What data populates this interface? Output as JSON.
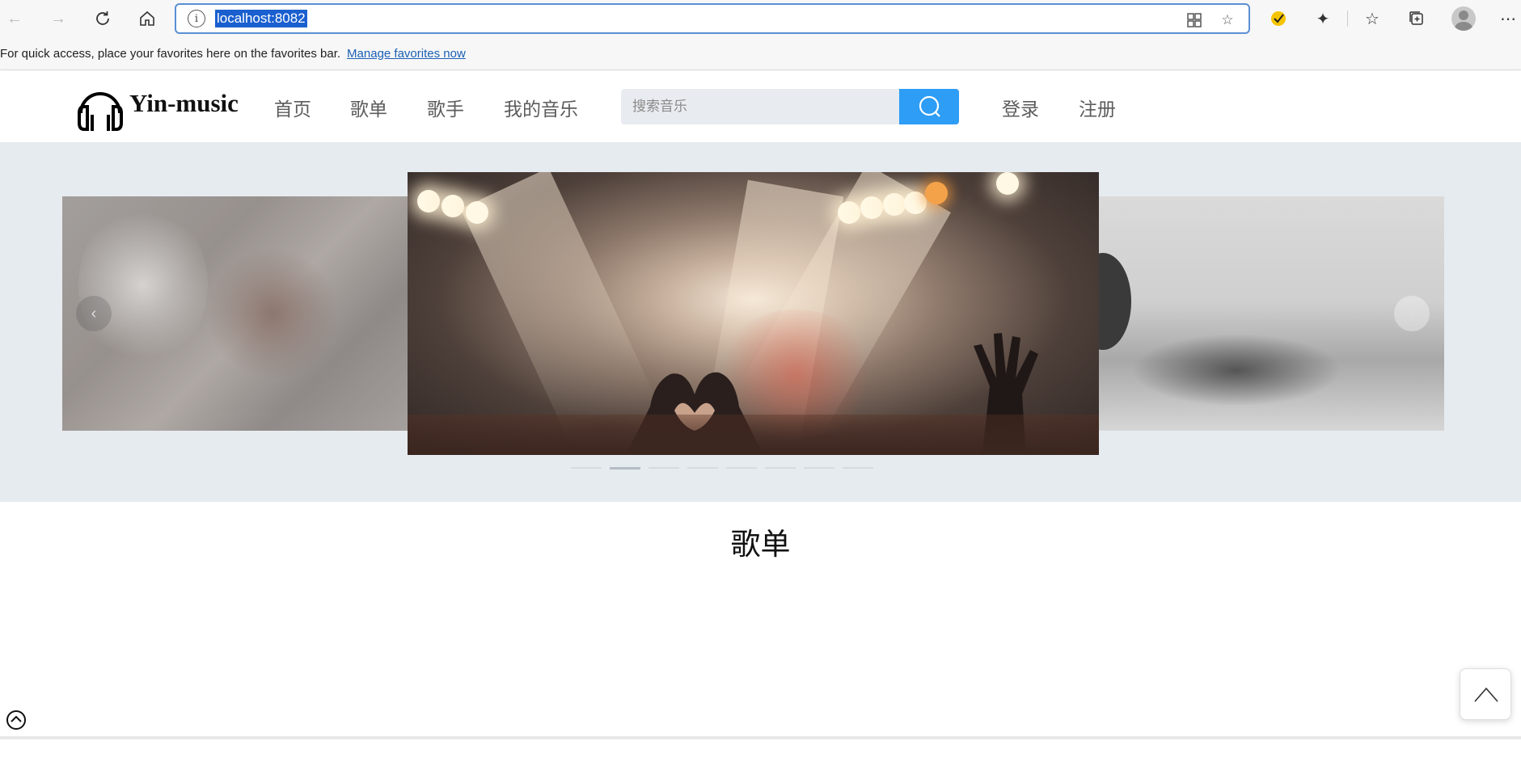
{
  "browser": {
    "url": "localhost:8082",
    "favorites_bar": {
      "message": "For quick access, place your favorites here on the favorites bar.",
      "link": "Manage favorites now"
    },
    "icons": [
      "back-icon",
      "forward-icon",
      "refresh-icon",
      "home-icon",
      "site-info-icon",
      "app-available-icon",
      "add-favorite-icon",
      "extension-check-icon",
      "extensions-icon",
      "favorites-icon",
      "collections-icon",
      "profile-icon",
      "more-icon"
    ]
  },
  "site": {
    "logo_text": "Yin-music",
    "nav": [
      "首页",
      "歌单",
      "歌手",
      "我的音乐"
    ],
    "search": {
      "placeholder": "搜索音乐"
    },
    "auth": {
      "login": "登录",
      "register": "注册"
    }
  },
  "carousel": {
    "prev_label": "‹",
    "next_label": "›",
    "indicator_count": 8,
    "active_index": 1
  },
  "section": {
    "title": "歌单"
  }
}
